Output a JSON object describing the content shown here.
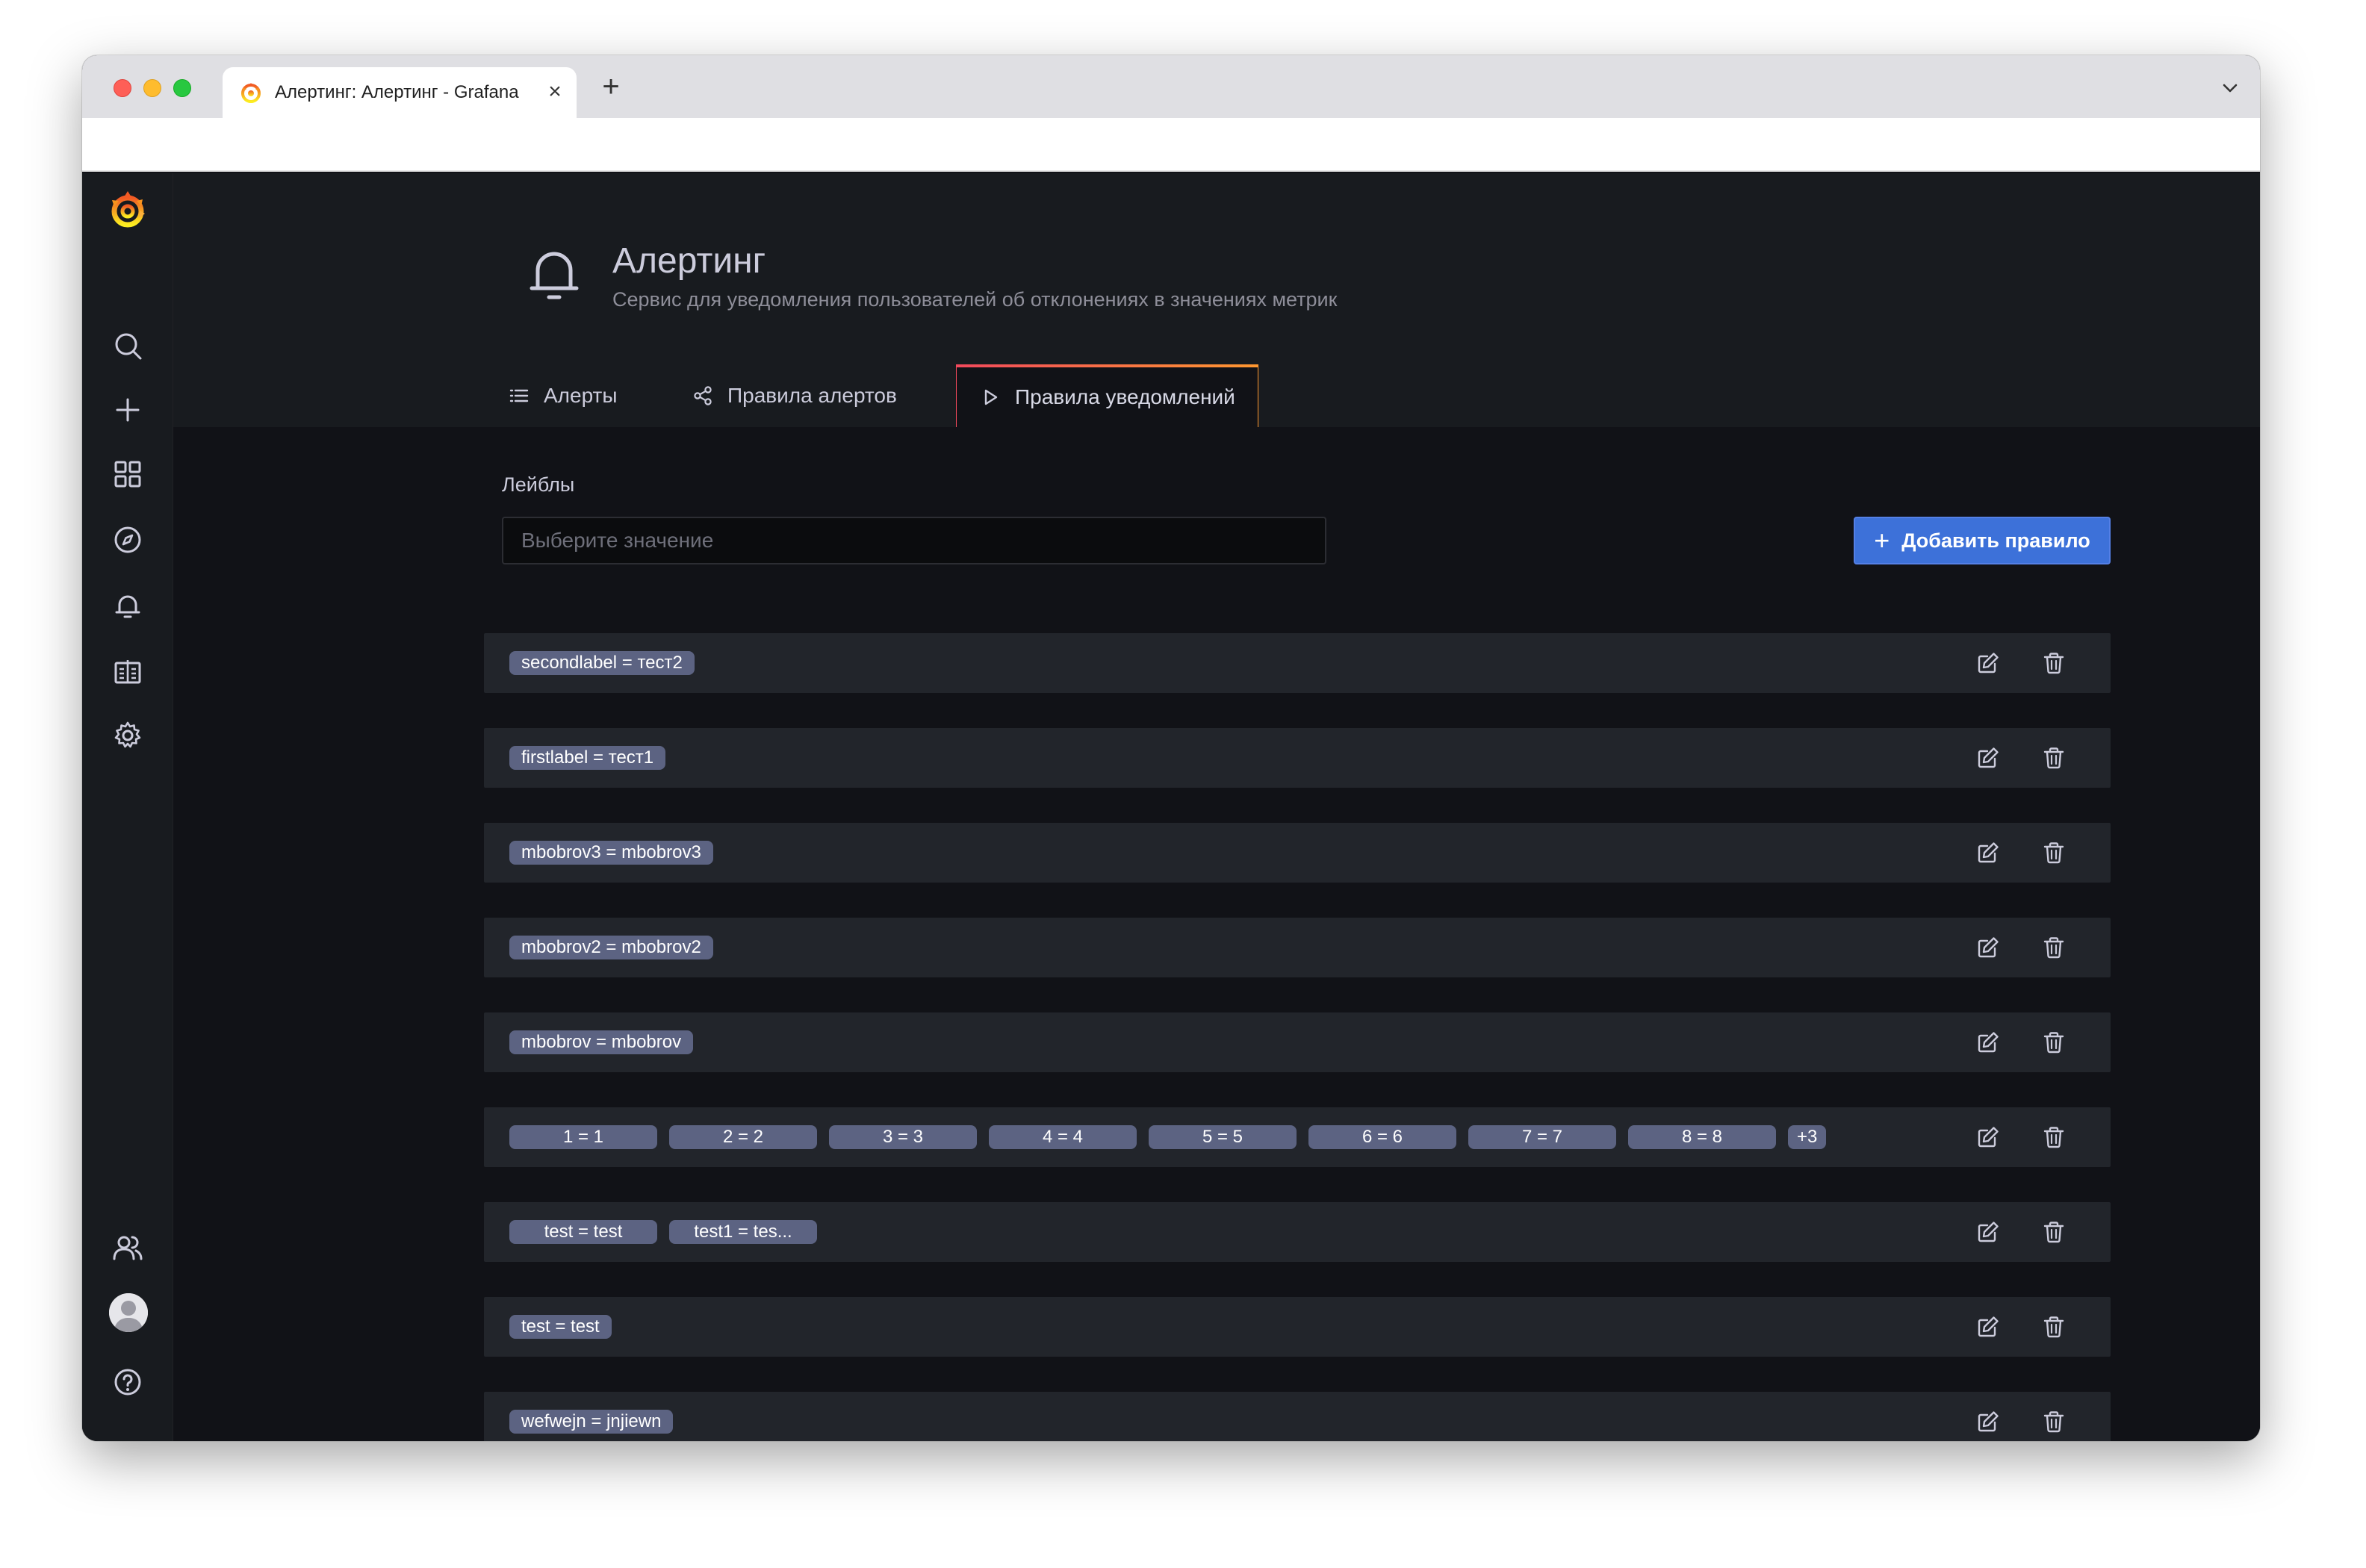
{
  "browser": {
    "tab_title": "Алертинг: Алертинг - Grafana",
    "close_glyph": "×",
    "new_tab_glyph": "+"
  },
  "header": {
    "title": "Алертинг",
    "subtitle": "Сервис для уведомления пользователей об отклонениях в значениях метрик",
    "icon": "bell-icon"
  },
  "tabs": [
    {
      "label": "Алерты",
      "icon": "list-icon",
      "active": false
    },
    {
      "label": "Правила алертов",
      "icon": "share-nodes-icon",
      "active": false
    },
    {
      "label": "Правила уведомлений",
      "icon": "play-icon",
      "active": true
    }
  ],
  "filter": {
    "label": "Лейблы",
    "placeholder": "Выберите значение",
    "value": ""
  },
  "actions": {
    "add_rule_label": "Добавить правило",
    "add_rule_glyph": "+"
  },
  "rules": [
    {
      "labels": [
        "secondlabel = тест2"
      ]
    },
    {
      "labels": [
        "firstlabel = тест1"
      ]
    },
    {
      "labels": [
        "mbobrov3 = mbobrov3"
      ]
    },
    {
      "labels": [
        "mbobrov2 = mbobrov2"
      ]
    },
    {
      "labels": [
        "mbobrov = mbobrov"
      ]
    },
    {
      "labels": [
        "1 = 1",
        "2 = 2",
        "3 = 3",
        "4 = 4",
        "5 = 5",
        "6 = 6",
        "7 = 7",
        "8 = 8"
      ],
      "more": "+3"
    },
    {
      "labels": [
        "test = test",
        "test1 = tes..."
      ]
    },
    {
      "labels": [
        "test = test"
      ]
    },
    {
      "labels": [
        "wefwejn = jnjiewn"
      ]
    }
  ],
  "colors": {
    "background": "#111217",
    "panel": "#181b1f",
    "row": "#22252b",
    "chip": "#5c6382",
    "primary": "#3d71d9",
    "text": "#ccccdc",
    "active_tab_gradient": [
      "#f2495c",
      "#ff9830"
    ]
  },
  "sidemenu": {
    "top_items": [
      "search-icon",
      "plus-icon",
      "dashboards-icon",
      "explore-icon",
      "alerting-icon",
      "reports-icon",
      "settings-icon"
    ],
    "bottom_items": [
      "users-icon",
      "avatar",
      "help-icon"
    ]
  }
}
